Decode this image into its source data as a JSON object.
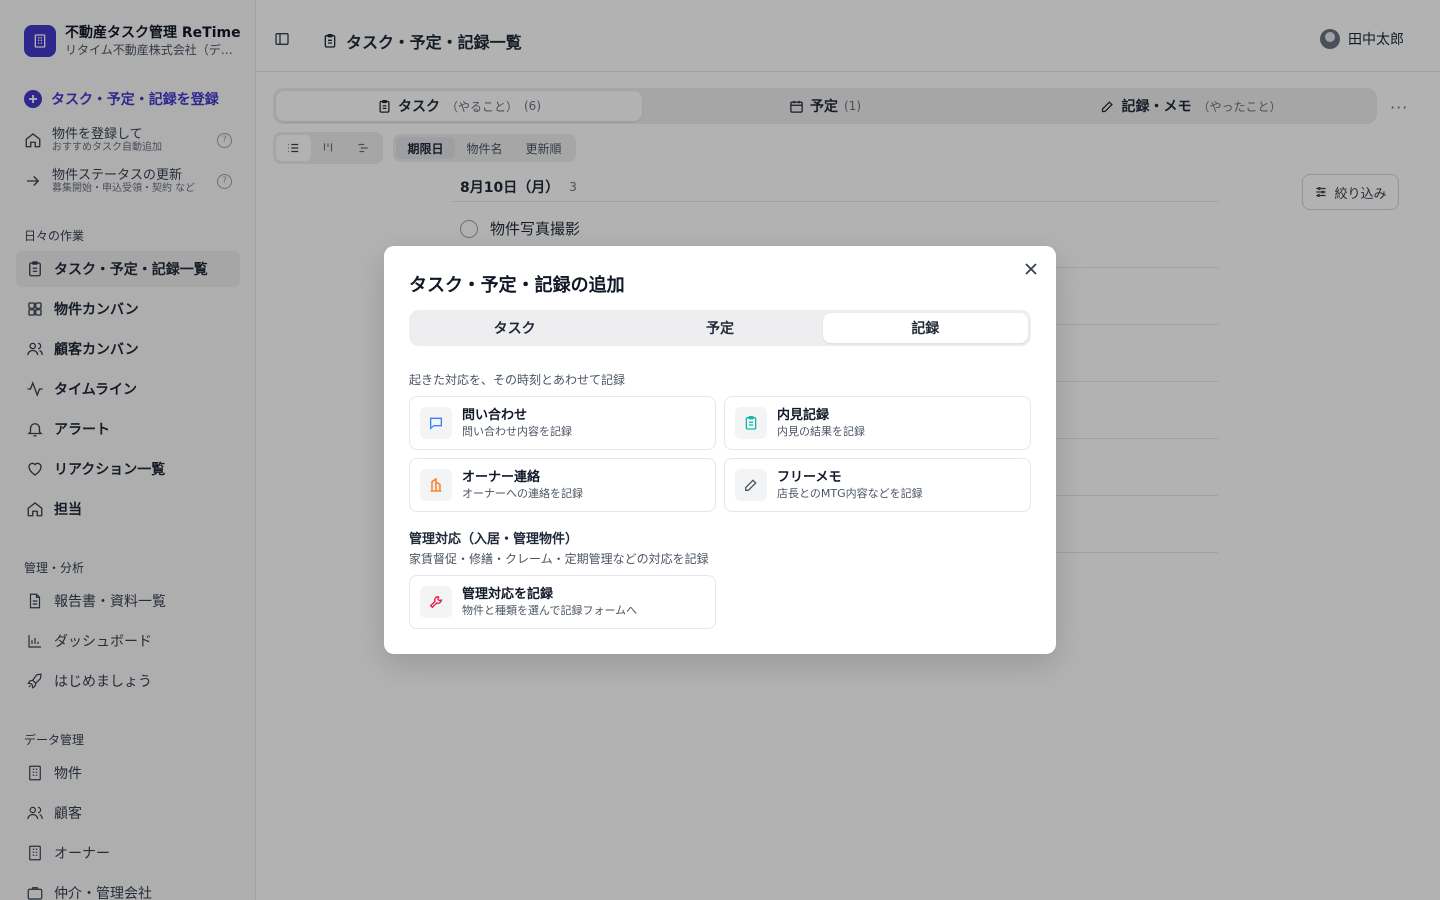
{
  "brand": {
    "title": "不動産タスク管理 ReTime",
    "subtitle": "リタイム不動産株式会社（デモ）"
  },
  "sidebar": {
    "primary_action": "タスク・予定・記録を登録",
    "quick_actions": [
      {
        "title": "物件を登録して",
        "subtitle": "おすすめタスク自動追加"
      },
      {
        "title": "物件ステータスの更新",
        "subtitle": "募集開始・申込受領・契約 など"
      }
    ],
    "daily_label": "日々の作業",
    "daily_items": [
      {
        "label": "タスク・予定・記録一覧"
      },
      {
        "label": "物件カンバン"
      },
      {
        "label": "顧客カンバン"
      },
      {
        "label": "タイムライン"
      },
      {
        "label": "アラート"
      },
      {
        "label": "リアクション一覧"
      },
      {
        "label": "担当"
      }
    ],
    "manage_label": "管理・分析",
    "manage_items": [
      {
        "label": "報告書・資料一覧"
      },
      {
        "label": "ダッシュボード"
      },
      {
        "label": "はじめましょう"
      }
    ],
    "data_label": "データ管理",
    "data_items": [
      {
        "label": "物件"
      },
      {
        "label": "顧客"
      },
      {
        "label": "オーナー"
      },
      {
        "label": "仲介・管理会社"
      }
    ]
  },
  "header": {
    "title": "タスク・予定・記録一覧",
    "user_name": "田中太郎"
  },
  "main_tabs": [
    {
      "label": "タスク",
      "hint": "（やること）",
      "count": "(6)"
    },
    {
      "label": "予定",
      "hint": "",
      "count": "(1)"
    },
    {
      "label": "記録・メモ",
      "hint": "（やったこと）",
      "count": ""
    }
  ],
  "sort_options": [
    "期限日",
    "物件名",
    "更新順"
  ],
  "filter_label": "絞り込み",
  "list": {
    "date_label": "8月10日（月）",
    "date_count": "3",
    "first_task": "物件写真撮影"
  },
  "modal": {
    "title": "タスク・予定・記録の追加",
    "tabs": [
      "タスク",
      "予定",
      "記録"
    ],
    "record_desc": "起きた対応を、その時刻とあわせて記録",
    "cards": [
      {
        "title": "問い合わせ",
        "subtitle": "問い合わせ内容を記録"
      },
      {
        "title": "内見記録",
        "subtitle": "内見の結果を記録"
      },
      {
        "title": "オーナー連絡",
        "subtitle": "オーナーへの連絡を記録"
      },
      {
        "title": "フリーメモ",
        "subtitle": "店長とのMTG内容などを記録"
      }
    ],
    "management_title": "管理対応（入居・管理物件）",
    "management_desc": "家賃督促・修繕・クレーム・定期管理などの対応を記録",
    "management_card": {
      "title": "管理対応を記録",
      "subtitle": "物件と種類を選んで記録フォームへ"
    }
  },
  "colors": {
    "brand": "#4338ca",
    "chat_icon": "#3b82f6",
    "clipboard_icon": "#14b8a6",
    "building_icon": "#f97316",
    "wrench_icon": "#e11d48"
  }
}
